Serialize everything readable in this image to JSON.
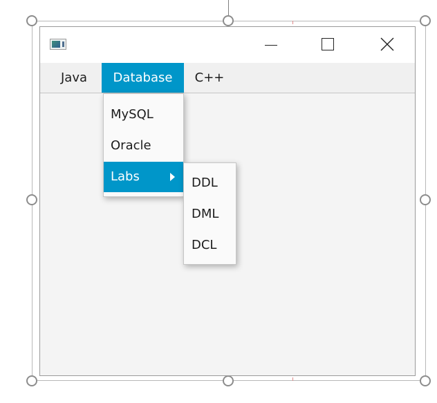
{
  "window": {
    "title": ""
  },
  "menubar": {
    "items": [
      {
        "label": "Java"
      },
      {
        "label": "Database"
      },
      {
        "label": "C++"
      }
    ]
  },
  "database_menu": {
    "items": [
      {
        "label": "MySQL"
      },
      {
        "label": "Oracle"
      },
      {
        "label": "Labs"
      }
    ]
  },
  "labs_submenu": {
    "items": [
      {
        "label": "DDL"
      },
      {
        "label": "DML"
      },
      {
        "label": "DCL"
      }
    ]
  },
  "colors": {
    "accent": "#0096c9",
    "menubar_bg": "#f0f0f0",
    "content_bg": "#f4f4f4"
  },
  "icons": {
    "app": "app-window-icon",
    "minimize": "minimize-icon",
    "maximize": "maximize-icon",
    "close": "close-icon",
    "submenu_arrow": "chevron-right-icon"
  }
}
